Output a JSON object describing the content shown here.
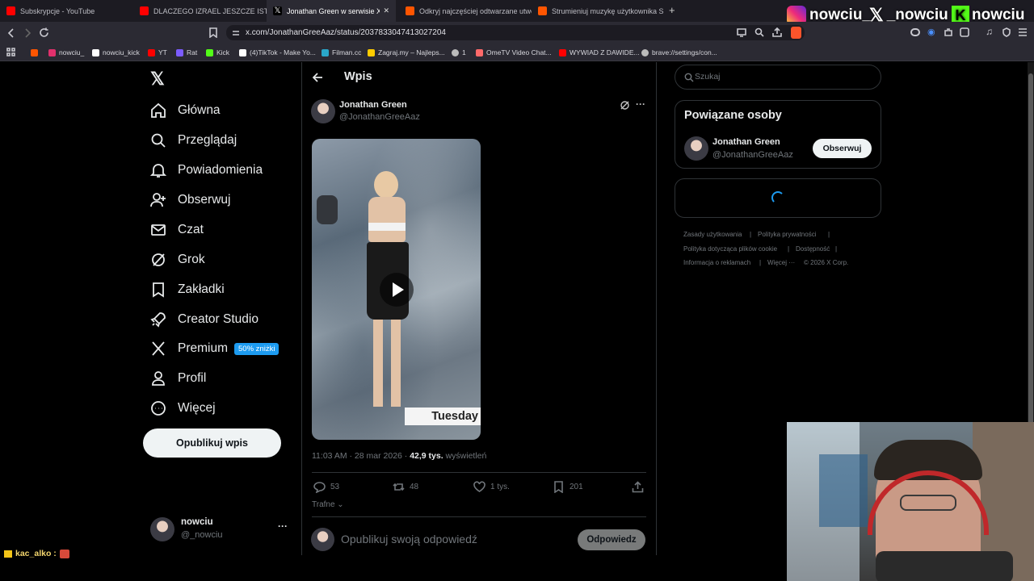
{
  "browser": {
    "tabs": [
      {
        "title": "Subskrypcje - YouTube",
        "color": "#ff0000"
      },
      {
        "title": "DLACZEGO IZRAEL JESZCZE ISTNIEJE",
        "color": "#ff0000"
      },
      {
        "title": "Jonathan Green w serwisie X: „ht",
        "color": "#ffffff"
      },
      {
        "title": "Odkryj najczęściej odtwarzane utwor",
        "color": "#ff5500"
      },
      {
        "title": "Strumieniuj muzykę użytkownika SFW",
        "color": "#ff5500"
      }
    ],
    "new_tab": "+",
    "url": "x.com/JonathanGreeAaz/status/2037833047413027204",
    "bookmarks": [
      {
        "label": "",
        "color": "#ff5500"
      },
      {
        "label": "nowciu_",
        "color": "#e1306c"
      },
      {
        "label": "nowciu_kick",
        "color": "#ffffff"
      },
      {
        "label": "YT",
        "color": "#ff0000"
      },
      {
        "label": "Rat",
        "color": "#7c5cff"
      },
      {
        "label": "Kick",
        "color": "#53fc18"
      },
      {
        "label": "(4)TikTok - Make Yo...",
        "color": "#ffffff"
      },
      {
        "label": "Filman.cc",
        "color": "#2aa7c9"
      },
      {
        "label": "Zagraj.my – Najleps...",
        "color": "#ffcc00"
      },
      {
        "label": "1",
        "color": "#bbbbbb"
      },
      {
        "label": "OmeTV Video Chat...",
        "color": "#ff6a6a"
      },
      {
        "label": "WYWIAD Z DAWIDE...",
        "color": "#ff0000"
      },
      {
        "label": "brave://settings/con...",
        "color": "#bbbbbb"
      }
    ]
  },
  "overlay": {
    "instagram": "nowciu_",
    "x": "_nowciu",
    "kick": "nowciu",
    "chat_user": "kac_alko :"
  },
  "sidebar": {
    "items": [
      {
        "label": "Główna",
        "icon": "home-icon"
      },
      {
        "label": "Przeglądaj",
        "icon": "search-icon"
      },
      {
        "label": "Powiadomienia",
        "icon": "bell-icon"
      },
      {
        "label": "Obserwuj",
        "icon": "follow-icon"
      },
      {
        "label": "Czat",
        "icon": "mail-icon"
      },
      {
        "label": "Grok",
        "icon": "grok-icon"
      },
      {
        "label": "Zakładki",
        "icon": "bookmark-icon"
      },
      {
        "label": "Creator Studio",
        "icon": "rocket-icon"
      },
      {
        "label": "Premium",
        "icon": "x-icon"
      },
      {
        "label": "Profil",
        "icon": "person-icon"
      },
      {
        "label": "Więcej",
        "icon": "more-icon"
      }
    ],
    "premium_badge": "50% zniżki",
    "post_button": "Opublikuj wpis",
    "account": {
      "name": "nowciu",
      "handle": "@_nowciu",
      "menu": "···"
    }
  },
  "post": {
    "header": "Wpis",
    "author": {
      "name": "Jonathan Green",
      "handle": "@JonathanGreeAaz"
    },
    "video_caption": "Tuesday",
    "time": "11:03 AM · 28 mar 2026 · ",
    "views_count": "42,9 tys.",
    "views_label": " wyświetleń",
    "stats": {
      "replies": "53",
      "reposts": "48",
      "likes": "1 tys.",
      "bookmarks": "201"
    },
    "sort_label": "Trafne",
    "reply_placeholder": "Opublikuj swoją odpowiedź",
    "reply_button": "Odpowiedz"
  },
  "right": {
    "search_placeholder": "Szukaj",
    "related_title": "Powiązane osoby",
    "related_person": {
      "name": "Jonathan Green",
      "handle": "@JonathanGreeAaz"
    },
    "follow_button": "Obserwuj",
    "footer": [
      "Zasady użytkowania",
      "|",
      "Polityka prywatności",
      "|",
      "Polityka dotycząca plików cookie",
      "|",
      "Dostępność",
      "|",
      "Informacja o reklamach",
      "|",
      "Więcej ···",
      "© 2026 X Corp."
    ]
  },
  "colors": {
    "accent": "#1d9bf0",
    "background": "#000000",
    "border": "#2f3336"
  }
}
